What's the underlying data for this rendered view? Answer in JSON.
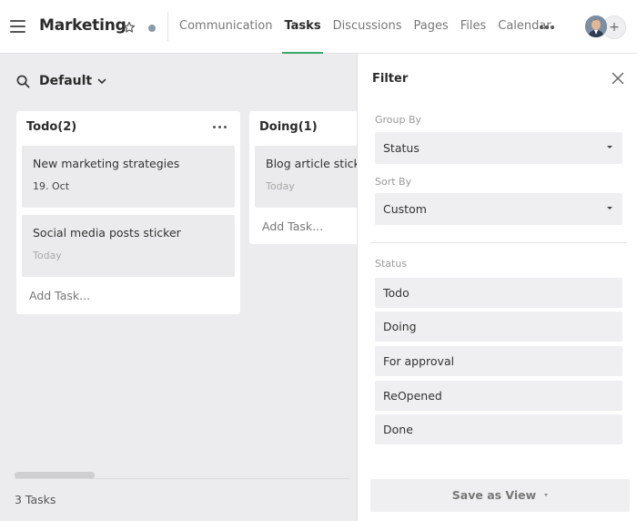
{
  "header": {
    "title": "Marketing",
    "tabs": [
      {
        "label": "Communication",
        "active": false
      },
      {
        "label": "Tasks",
        "active": true
      },
      {
        "label": "Discussions",
        "active": false
      },
      {
        "label": "Pages",
        "active": false
      },
      {
        "label": "Files",
        "active": false
      },
      {
        "label": "Calendar",
        "active": false
      }
    ],
    "add_member_label": "+",
    "accent_color": "#3aa76d"
  },
  "view": {
    "name": "Default"
  },
  "board": {
    "columns": [
      {
        "title": "Todo(2)",
        "cards": [
          {
            "title": "New marketing strategies",
            "date": "19. Oct"
          },
          {
            "title": "Social media posts sticker",
            "date": "Today"
          }
        ],
        "add_task_label": "Add Task..."
      },
      {
        "title": "Doing(1)",
        "cards": [
          {
            "title": "Blog article sticker",
            "date": "Today"
          }
        ],
        "add_task_label": "Add Task..."
      }
    ],
    "task_count": "3 Tasks"
  },
  "filter": {
    "title": "Filter",
    "group_by": {
      "label": "Group By",
      "value": "Status"
    },
    "sort_by": {
      "label": "Sort By",
      "value": "Custom"
    },
    "status": {
      "label": "Status",
      "options": [
        "Todo",
        "Doing",
        "For approval",
        "ReOpened",
        "Done"
      ]
    },
    "save_view_label": "Save as View"
  }
}
